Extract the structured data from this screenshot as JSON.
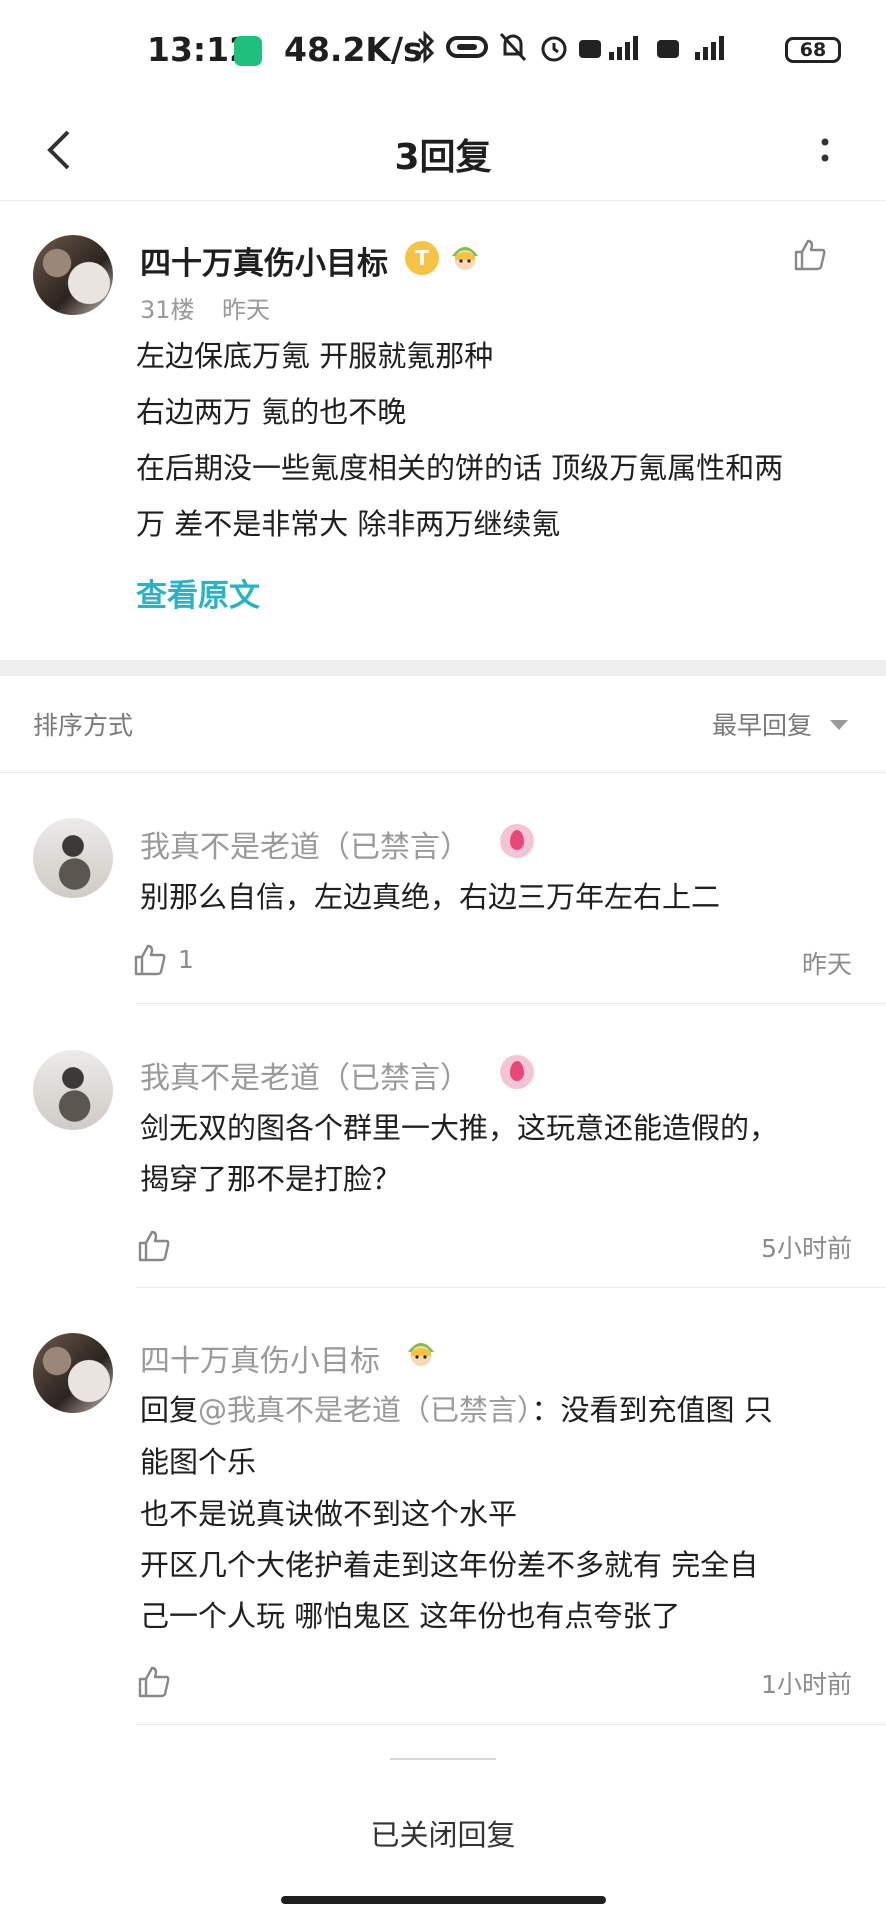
{
  "status_bar": {
    "time": "13:12",
    "net_speed": "48.2K/s",
    "battery": "68"
  },
  "nav": {
    "title": "3回复"
  },
  "post": {
    "author": "四十万真伤小目标",
    "coin_badge": "T",
    "floor": "31楼",
    "time": "昨天",
    "lines": [
      "左边保底万氪 开服就氪那种",
      "右边两万 氪的也不晚",
      "在后期没一些氪度相关的饼的话 顶级万氪属性和两",
      "万 差不是非常大 除非两万继续氪"
    ],
    "view_original": "查看原文"
  },
  "sort": {
    "label": "排序方式",
    "value": "最早回复"
  },
  "replies": [
    {
      "author": "我真不是老道（已禁言）",
      "lines": [
        "别那么自信，左边真绝，右边三万年左右上二"
      ],
      "likes": "1",
      "time": "昨天"
    },
    {
      "author": "我真不是老道（已禁言）",
      "lines": [
        "剑无双的图各个群里一大推，这玩意还能造假的，",
        "揭穿了那不是打脸？"
      ],
      "likes": "",
      "time": "5小时前"
    },
    {
      "author": "四十万真伤小目标",
      "reply_prefix": "回复",
      "mention": "@我真不是老道（已禁言）",
      "first_rest": "：没看到充值图 只",
      "lines": [
        "能图个乐",
        "也不是说真诀做不到这个水平",
        "开区几个大佬护着走到这年份差不多就有 完全自",
        "己一个人玩 哪怕鬼区 这年份也有点夸张了"
      ],
      "likes": "",
      "time": "1小时前"
    }
  ],
  "footer": {
    "closed_label": "已关闭回复"
  }
}
